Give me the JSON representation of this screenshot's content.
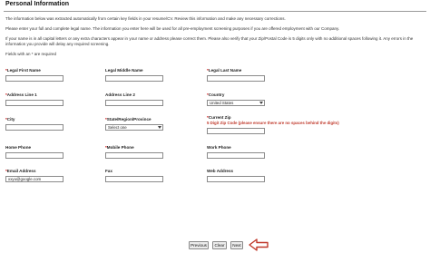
{
  "section_title": "Personal Information",
  "intro": {
    "line1": "The information below was extracted automatically from certain key fields in your resume/CV. Review this information and make any necessary corrections.",
    "line2": "Please enter your full and complete legal name. The information you enter here will be used for all pre-employment screening purposes if you are offered employment with our Company.",
    "line3a": "If your name is in all capital letters or any extra characters appear in your name or address please correct them. Please also verify that your Zip/Postal Code is 5 digits only with no additional spaces following it. Any errors in the",
    "line3b": "information you provide will delay any required screening.",
    "required_note": "Fields with an * are required"
  },
  "fields": {
    "first_name": {
      "label": "Legal First Name",
      "value": ""
    },
    "middle_name": {
      "label": "Legal Middle Name",
      "value": ""
    },
    "last_name": {
      "label": "Legal Last Name",
      "value": ""
    },
    "address1": {
      "label": "Address Line 1",
      "value": ""
    },
    "address2": {
      "label": "Address Line 2",
      "value": ""
    },
    "country": {
      "label": "Country",
      "value": "United States"
    },
    "city": {
      "label": "City",
      "value": ""
    },
    "state": {
      "label": "State/Region/Province",
      "value": "Select one"
    },
    "zip": {
      "label": "Current Zip",
      "note": "5 Digit Zip Code (please ensure there are no spaces behind the digits)",
      "value": ""
    },
    "home_phone": {
      "label": "Home Phone",
      "value": ""
    },
    "mobile_phone": {
      "label": "Mobile Phone",
      "value": ""
    },
    "work_phone": {
      "label": "Work Phone",
      "value": ""
    },
    "email": {
      "label": "Email Address",
      "value": "xxyu@google.com"
    },
    "fax": {
      "label": "Fax",
      "value": ""
    },
    "web_address": {
      "label": "Web Address",
      "value": ""
    }
  },
  "required_marker": "*",
  "buttons": {
    "previous": "Previous",
    "clear": "Clear",
    "next": "Next"
  },
  "colors": {
    "required": "#cc0000",
    "zip_note": "#c0392b",
    "arrow": "#c0392b"
  }
}
